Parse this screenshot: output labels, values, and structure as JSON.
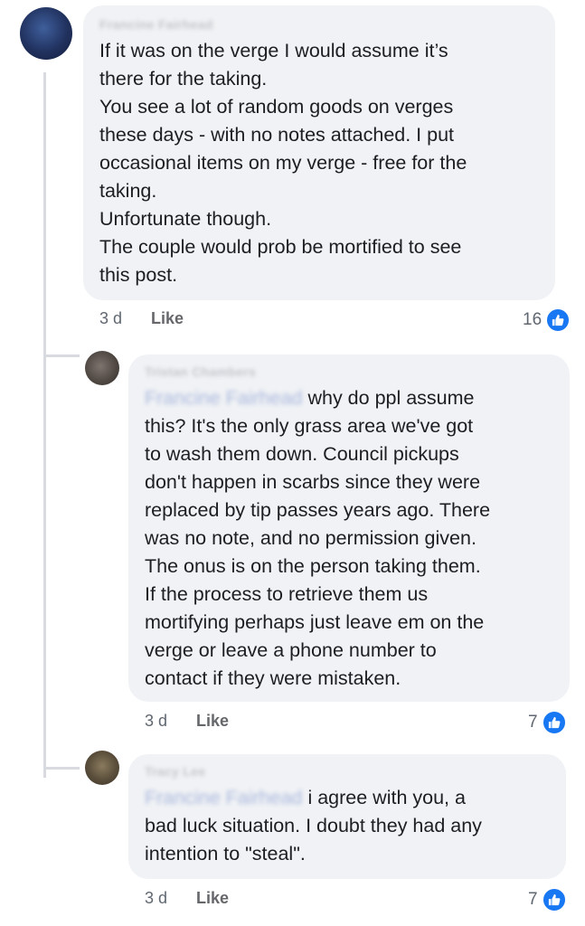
{
  "comments": [
    {
      "author": "Francine Fairhead",
      "lines": [
        "If it was on the verge I would assume it’s",
        "there for the taking.",
        "You see a lot of random goods on verges",
        "these days - with no notes attached.  I put",
        "occasional items on my verge - free for the",
        "taking.",
        "Unfortunate though.",
        "The couple would prob be mortified to see",
        "this post."
      ],
      "time": "3 d",
      "like_label": "Like",
      "reaction_count": "16"
    },
    {
      "author": "Tristan Chambers",
      "mention": "Francine Fairhead",
      "first_line_rest": "why do ppl assume",
      "lines": [
        "this? It's the only grass area we've got",
        "to wash them down. Council pickups",
        "don't happen in scarbs since they were",
        "replaced by tip passes years ago. There",
        "was no note, and no permission given.",
        "The onus is on the person taking them.",
        "If the process to retrieve them us",
        "mortifying perhaps just leave em on the",
        "verge or leave a phone number to",
        "contact if they were mistaken."
      ],
      "time": "3 d",
      "like_label": "Like",
      "reaction_count": "7"
    },
    {
      "author": "Tracy Lee",
      "mention": "Francine Fairhead",
      "first_line_rest": "i agree with you, a",
      "lines": [
        "bad luck situation. I doubt they had any",
        "intention to \"steal\"."
      ],
      "time": "3 d",
      "like_label": "Like",
      "reaction_count": "7"
    }
  ],
  "colors": {
    "bubble": "#f0f2f5",
    "like_blue": "#1877f2",
    "meta_gray": "#606770"
  }
}
